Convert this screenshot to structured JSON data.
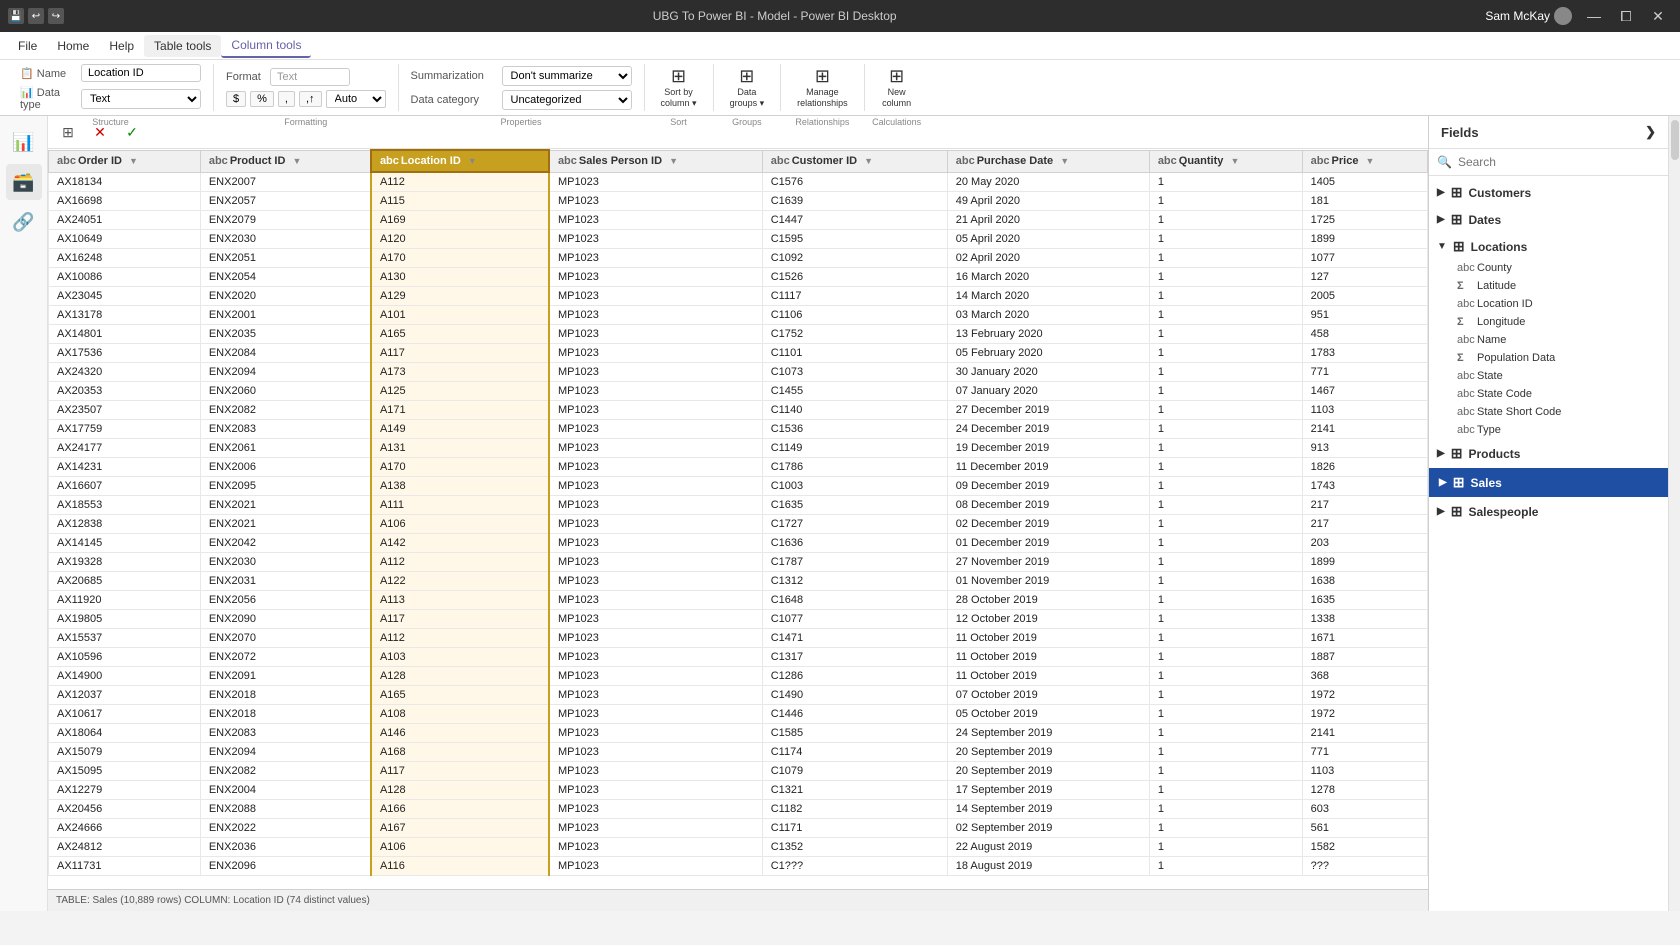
{
  "titleBar": {
    "title": "UBG To Power BI - Model - Power BI Desktop",
    "user": "Sam McKay",
    "icons": [
      "save",
      "undo",
      "redo"
    ]
  },
  "menuBar": {
    "items": [
      "File",
      "Home",
      "Help",
      "Table tools",
      "Column tools"
    ]
  },
  "ribbon": {
    "structureGroup": {
      "label": "Structure",
      "nameLabel": "Name",
      "nameValue": "Location ID",
      "dataTypeLabel": "Data type",
      "dataTypeValue": "Text"
    },
    "formattingGroup": {
      "label": "Formatting",
      "formatLabel": "Format",
      "formatValue": "Text",
      "buttons": [
        "$",
        "%",
        "↓",
        "↑"
      ],
      "autoLabel": "Auto"
    },
    "propertiesGroup": {
      "label": "Properties",
      "summarizationLabel": "Summarization",
      "summarizationValue": "Don't summarize",
      "dataCategoryLabel": "Data category",
      "dataCategoryValue": "Uncategorized"
    },
    "sortGroup": {
      "label": "Sort",
      "sortByColumn": "Sort by\ncolumn"
    },
    "groupsGroup": {
      "label": "Groups",
      "dataGroups": "Data\ngroups"
    },
    "relationshipsGroup": {
      "label": "Relationships",
      "manageRelationships": "Manage\nrelationships"
    },
    "calculationsGroup": {
      "label": "Calculations",
      "newColumn": "New\ncolumn"
    }
  },
  "tableToolbar": {
    "cancelTitle": "Cancel",
    "confirmTitle": "Confirm"
  },
  "table": {
    "columns": [
      {
        "name": "Order ID",
        "icon": "abc",
        "hasFilter": true,
        "hasSort": true
      },
      {
        "name": "Product ID",
        "icon": "abc",
        "hasFilter": true,
        "hasSort": true
      },
      {
        "name": "Location ID",
        "icon": "abc",
        "hasFilter": true,
        "hasSort": true,
        "selected": true
      },
      {
        "name": "Sales Person ID",
        "icon": "abc",
        "hasFilter": true,
        "hasSort": true
      },
      {
        "name": "Customer ID",
        "icon": "abc",
        "hasFilter": true,
        "hasSort": true
      },
      {
        "name": "Purchase Date",
        "icon": "abc",
        "hasFilter": true,
        "hasSort": true
      },
      {
        "name": "Quantity",
        "icon": "abc",
        "hasFilter": true,
        "hasSort": true
      },
      {
        "name": "Price",
        "icon": "abc",
        "hasFilter": true,
        "hasSort": true
      }
    ],
    "rows": [
      [
        "AX18134",
        "ENX2007",
        "A112",
        "MP1023",
        "C1576",
        "20 May 2020",
        "1",
        "1405"
      ],
      [
        "AX16698",
        "ENX2057",
        "A115",
        "MP1023",
        "C1639",
        "49 April 2020",
        "1",
        "181"
      ],
      [
        "AX24051",
        "ENX2079",
        "A169",
        "MP1023",
        "C1447",
        "21 April 2020",
        "1",
        "1725"
      ],
      [
        "AX10649",
        "ENX2030",
        "A120",
        "MP1023",
        "C1595",
        "05 April 2020",
        "1",
        "1899"
      ],
      [
        "AX16248",
        "ENX2051",
        "A170",
        "MP1023",
        "C1092",
        "02 April 2020",
        "1",
        "1077"
      ],
      [
        "AX10086",
        "ENX2054",
        "A130",
        "MP1023",
        "C1526",
        "16 March 2020",
        "1",
        "127"
      ],
      [
        "AX23045",
        "ENX2020",
        "A129",
        "MP1023",
        "C1117",
        "14 March 2020",
        "1",
        "2005"
      ],
      [
        "AX13178",
        "ENX2001",
        "A101",
        "MP1023",
        "C1106",
        "03 March 2020",
        "1",
        "951"
      ],
      [
        "AX14801",
        "ENX2035",
        "A165",
        "MP1023",
        "C1752",
        "13 February 2020",
        "1",
        "458"
      ],
      [
        "AX17536",
        "ENX2084",
        "A117",
        "MP1023",
        "C1101",
        "05 February 2020",
        "1",
        "1783"
      ],
      [
        "AX24320",
        "ENX2094",
        "A173",
        "MP1023",
        "C1073",
        "30 January 2020",
        "1",
        "771"
      ],
      [
        "AX20353",
        "ENX2060",
        "A125",
        "MP1023",
        "C1455",
        "07 January 2020",
        "1",
        "1467"
      ],
      [
        "AX23507",
        "ENX2082",
        "A171",
        "MP1023",
        "C1140",
        "27 December 2019",
        "1",
        "1103"
      ],
      [
        "AX17759",
        "ENX2083",
        "A149",
        "MP1023",
        "C1536",
        "24 December 2019",
        "1",
        "2141"
      ],
      [
        "AX24177",
        "ENX2061",
        "A131",
        "MP1023",
        "C1149",
        "19 December 2019",
        "1",
        "913"
      ],
      [
        "AX14231",
        "ENX2006",
        "A170",
        "MP1023",
        "C1786",
        "11 December 2019",
        "1",
        "1826"
      ],
      [
        "AX16607",
        "ENX2095",
        "A138",
        "MP1023",
        "C1003",
        "09 December 2019",
        "1",
        "1743"
      ],
      [
        "AX18553",
        "ENX2021",
        "A111",
        "MP1023",
        "C1635",
        "08 December 2019",
        "1",
        "217"
      ],
      [
        "AX12838",
        "ENX2021",
        "A106",
        "MP1023",
        "C1727",
        "02 December 2019",
        "1",
        "217"
      ],
      [
        "AX14145",
        "ENX2042",
        "A142",
        "MP1023",
        "C1636",
        "01 December 2019",
        "1",
        "203"
      ],
      [
        "AX19328",
        "ENX2030",
        "A112",
        "MP1023",
        "C1787",
        "27 November 2019",
        "1",
        "1899"
      ],
      [
        "AX20685",
        "ENX2031",
        "A122",
        "MP1023",
        "C1312",
        "01 November 2019",
        "1",
        "1638"
      ],
      [
        "AX11920",
        "ENX2056",
        "A113",
        "MP1023",
        "C1648",
        "28 October 2019",
        "1",
        "1635"
      ],
      [
        "AX19805",
        "ENX2090",
        "A117",
        "MP1023",
        "C1077",
        "12 October 2019",
        "1",
        "1338"
      ],
      [
        "AX15537",
        "ENX2070",
        "A112",
        "MP1023",
        "C1471",
        "11 October 2019",
        "1",
        "1671"
      ],
      [
        "AX10596",
        "ENX2072",
        "A103",
        "MP1023",
        "C1317",
        "11 October 2019",
        "1",
        "1887"
      ],
      [
        "AX14900",
        "ENX2091",
        "A128",
        "MP1023",
        "C1286",
        "11 October 2019",
        "1",
        "368"
      ],
      [
        "AX12037",
        "ENX2018",
        "A165",
        "MP1023",
        "C1490",
        "07 October 2019",
        "1",
        "1972"
      ],
      [
        "AX10617",
        "ENX2018",
        "A108",
        "MP1023",
        "C1446",
        "05 October 2019",
        "1",
        "1972"
      ],
      [
        "AX18064",
        "ENX2083",
        "A146",
        "MP1023",
        "C1585",
        "24 September 2019",
        "1",
        "2141"
      ],
      [
        "AX15079",
        "ENX2094",
        "A168",
        "MP1023",
        "C1174",
        "20 September 2019",
        "1",
        "771"
      ],
      [
        "AX15095",
        "ENX2082",
        "A117",
        "MP1023",
        "C1079",
        "20 September 2019",
        "1",
        "1103"
      ],
      [
        "AX12279",
        "ENX2004",
        "A128",
        "MP1023",
        "C1321",
        "17 September 2019",
        "1",
        "1278"
      ],
      [
        "AX20456",
        "ENX2088",
        "A166",
        "MP1023",
        "C1182",
        "14 September 2019",
        "1",
        "603"
      ],
      [
        "AX24666",
        "ENX2022",
        "A167",
        "MP1023",
        "C1171",
        "02 September 2019",
        "1",
        "561"
      ],
      [
        "AX24812",
        "ENX2036",
        "A106",
        "MP1023",
        "C1352",
        "22 August 2019",
        "1",
        "1582"
      ],
      [
        "AX11731",
        "ENX2096",
        "A116",
        "MP1023",
        "C1???",
        "18 August 2019",
        "1",
        "???"
      ]
    ]
  },
  "statusBar": {
    "text": "TABLE: Sales (10,889 rows) COLUMN: Location ID (74 distinct values)"
  },
  "fieldsPanel": {
    "title": "Fields",
    "searchPlaceholder": "Search",
    "groups": [
      {
        "name": "Customers",
        "icon": "table",
        "expanded": false,
        "items": []
      },
      {
        "name": "Dates",
        "icon": "table",
        "expanded": false,
        "items": []
      },
      {
        "name": "Locations",
        "icon": "table",
        "expanded": true,
        "items": [
          {
            "name": "County",
            "type": "text",
            "icon": "abc"
          },
          {
            "name": "Latitude",
            "type": "number",
            "icon": "sigma"
          },
          {
            "name": "Location ID",
            "type": "text",
            "icon": "abc"
          },
          {
            "name": "Longitude",
            "type": "number",
            "icon": "sigma"
          },
          {
            "name": "Name",
            "type": "text",
            "icon": "abc"
          },
          {
            "name": "Population Data",
            "type": "number",
            "icon": "sigma"
          },
          {
            "name": "State",
            "type": "text",
            "icon": "abc"
          },
          {
            "name": "State Code",
            "type": "text",
            "icon": "abc"
          },
          {
            "name": "State Short Code",
            "type": "text",
            "icon": "abc"
          },
          {
            "name": "Type",
            "type": "text",
            "icon": "abc"
          }
        ]
      },
      {
        "name": "Products",
        "icon": "table",
        "expanded": false,
        "items": []
      },
      {
        "name": "Sales",
        "icon": "table",
        "expanded": false,
        "items": [],
        "selected": true
      },
      {
        "name": "Salespeople",
        "icon": "table",
        "expanded": false,
        "items": []
      }
    ]
  }
}
